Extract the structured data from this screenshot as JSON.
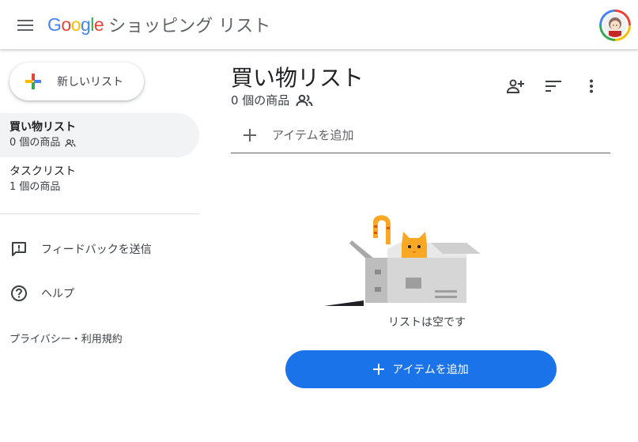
{
  "header": {
    "logo_text": "Google",
    "app_name": "ショッピング リスト",
    "icons": {
      "menu": "menu-icon",
      "avatar": "profile-avatar"
    }
  },
  "sidebar": {
    "new_list_label": "新しいリスト",
    "lists": [
      {
        "name": "買い物リスト",
        "count": "0 個の商品",
        "shared": true,
        "active": true
      },
      {
        "name": "タスクリスト",
        "count": "1 個の商品",
        "shared": false,
        "active": false
      }
    ],
    "feedback_label": "フィードバックを送信",
    "help_label": "ヘルプ",
    "privacy_label": "プライバシー・利用規約"
  },
  "main": {
    "title": "買い物リスト",
    "subtitle": "0 個の商品",
    "add_item_placeholder": "アイテムを追加",
    "empty_text": "リストは空です",
    "add_item_button": "アイテムを追加",
    "toolbar_icons": [
      "share-person-add-icon",
      "sort-icon",
      "more-vert-icon"
    ]
  },
  "colors": {
    "primary": "#1a73e8",
    "google_blue": "#4285f4",
    "google_red": "#ea4335",
    "google_yellow": "#fbbc05",
    "google_green": "#34a853"
  }
}
